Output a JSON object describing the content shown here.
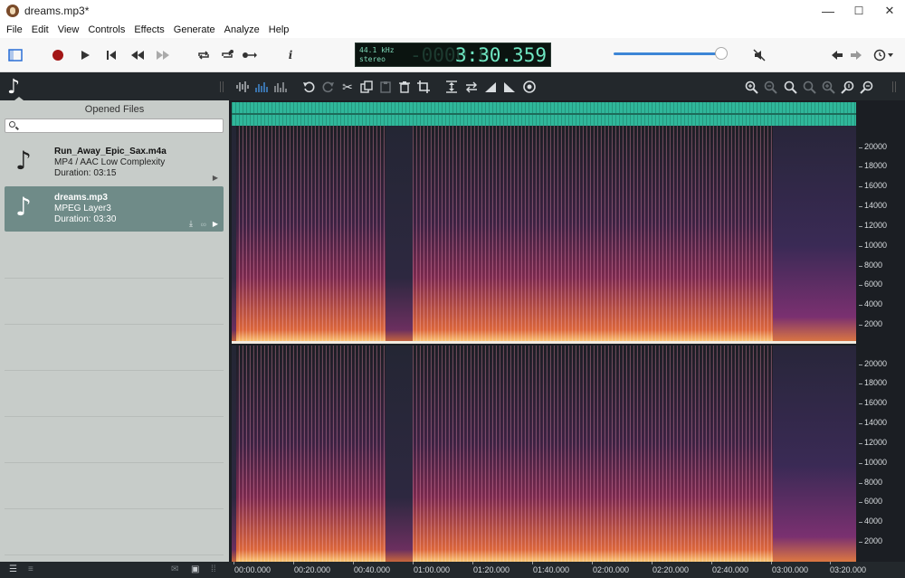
{
  "window": {
    "title": "dreams.mp3*"
  },
  "window_controls": {
    "minimize": "—",
    "maximize": "☐",
    "close": "✕"
  },
  "menu": [
    "File",
    "Edit",
    "View",
    "Controls",
    "Effects",
    "Generate",
    "Analyze",
    "Help"
  ],
  "display": {
    "sample_rate": "44.1 kHz",
    "channels": "stereo",
    "ghost_digits": "-0000:0",
    "time": "3:30.359"
  },
  "volume": {
    "level_percent": 93
  },
  "sidebar": {
    "title": "Opened Files",
    "search_placeholder": "",
    "files": [
      {
        "name": "Run_Away_Epic_Sax.m4a",
        "format": "MP4 / AAC Low Complexity",
        "duration": "Duration: 03:15",
        "active": false
      },
      {
        "name": "dreams.mp3",
        "format": "MPEG Layer3",
        "duration": "Duration: 03:30",
        "active": true
      }
    ]
  },
  "spectrogram": {
    "freq_labels": [
      "20000",
      "18000",
      "16000",
      "14000",
      "12000",
      "10000",
      "8000",
      "6000",
      "4000",
      "2000"
    ],
    "time_labels": [
      "00:00.000",
      "00:20.000",
      "00:40.000",
      "01:00.000",
      "01:20.000",
      "01:40.000",
      "02:00.000",
      "02:20.000",
      "02:40.000",
      "03:00.000",
      "03:20.000"
    ]
  },
  "colors": {
    "waveform": "#2fb79a",
    "display_text": "#6fe7c2",
    "volume_accent": "#3d86d6",
    "selected_file": "#6f8b88"
  }
}
